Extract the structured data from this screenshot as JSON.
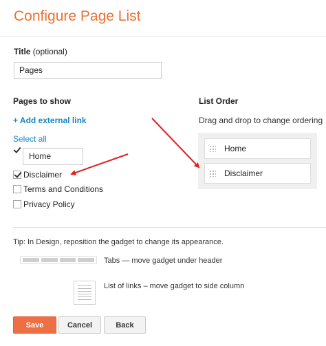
{
  "header": {
    "title": "Configure Page List"
  },
  "title_field": {
    "label": "Title",
    "label_suffix": "(optional)",
    "value": "Pages"
  },
  "pages_to_show": {
    "heading": "Pages to show",
    "add_link": "+ Add external link",
    "select_all": "Select all",
    "items": [
      {
        "label": "Home",
        "checked": true
      },
      {
        "label": "Disclaimer",
        "checked": true
      },
      {
        "label": "Terms and Conditions",
        "checked": false
      },
      {
        "label": "Privacy Policy",
        "checked": false
      }
    ]
  },
  "list_order": {
    "heading": "List Order",
    "instruction": "Drag and drop to change ordering",
    "items": [
      "Home",
      "Disclaimer"
    ]
  },
  "layout_tip": {
    "tip": "Tip: In Design, reposition the gadget to change its appearance.",
    "tabs_text": "Tabs — move gadget under header",
    "list_text": "List of links – move gadget to side column"
  },
  "buttons": {
    "save": "Save",
    "cancel": "Cancel",
    "back": "Back"
  },
  "colors": {
    "accent": "#ee6f2e",
    "link": "#1b86c9",
    "annotation_arrow": "#e02020"
  },
  "icons": [
    "checkbox-checked-icon",
    "checkbox-unchecked-icon",
    "drag-grip-icon",
    "tabs-layout-icon",
    "list-layout-icon"
  ]
}
